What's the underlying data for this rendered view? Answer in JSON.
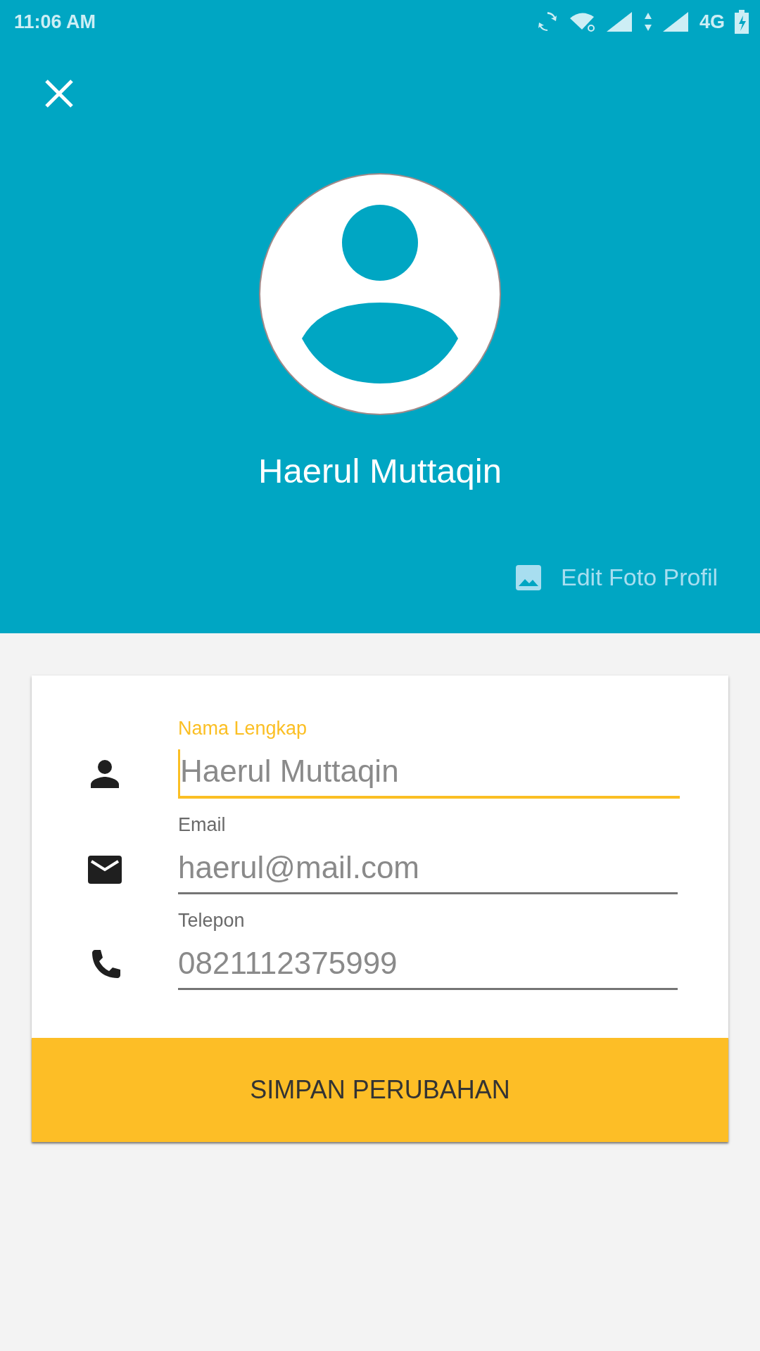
{
  "status_bar": {
    "time": "11:06 AM",
    "network": "4G"
  },
  "header": {
    "name": "Haerul Muttaqin",
    "edit_photo": "Edit Foto Profil"
  },
  "form": {
    "fields": [
      {
        "kind": "person",
        "label": "Nama Lengkap",
        "value": "Haerul Muttaqin",
        "focused": true
      },
      {
        "kind": "email",
        "label": "Email",
        "value": "haerul@mail.com",
        "focused": false
      },
      {
        "kind": "phone",
        "label": "Telepon",
        "value": "0821112375999",
        "focused": false
      }
    ],
    "save_button": "SIMPAN PERUBAHAN"
  }
}
